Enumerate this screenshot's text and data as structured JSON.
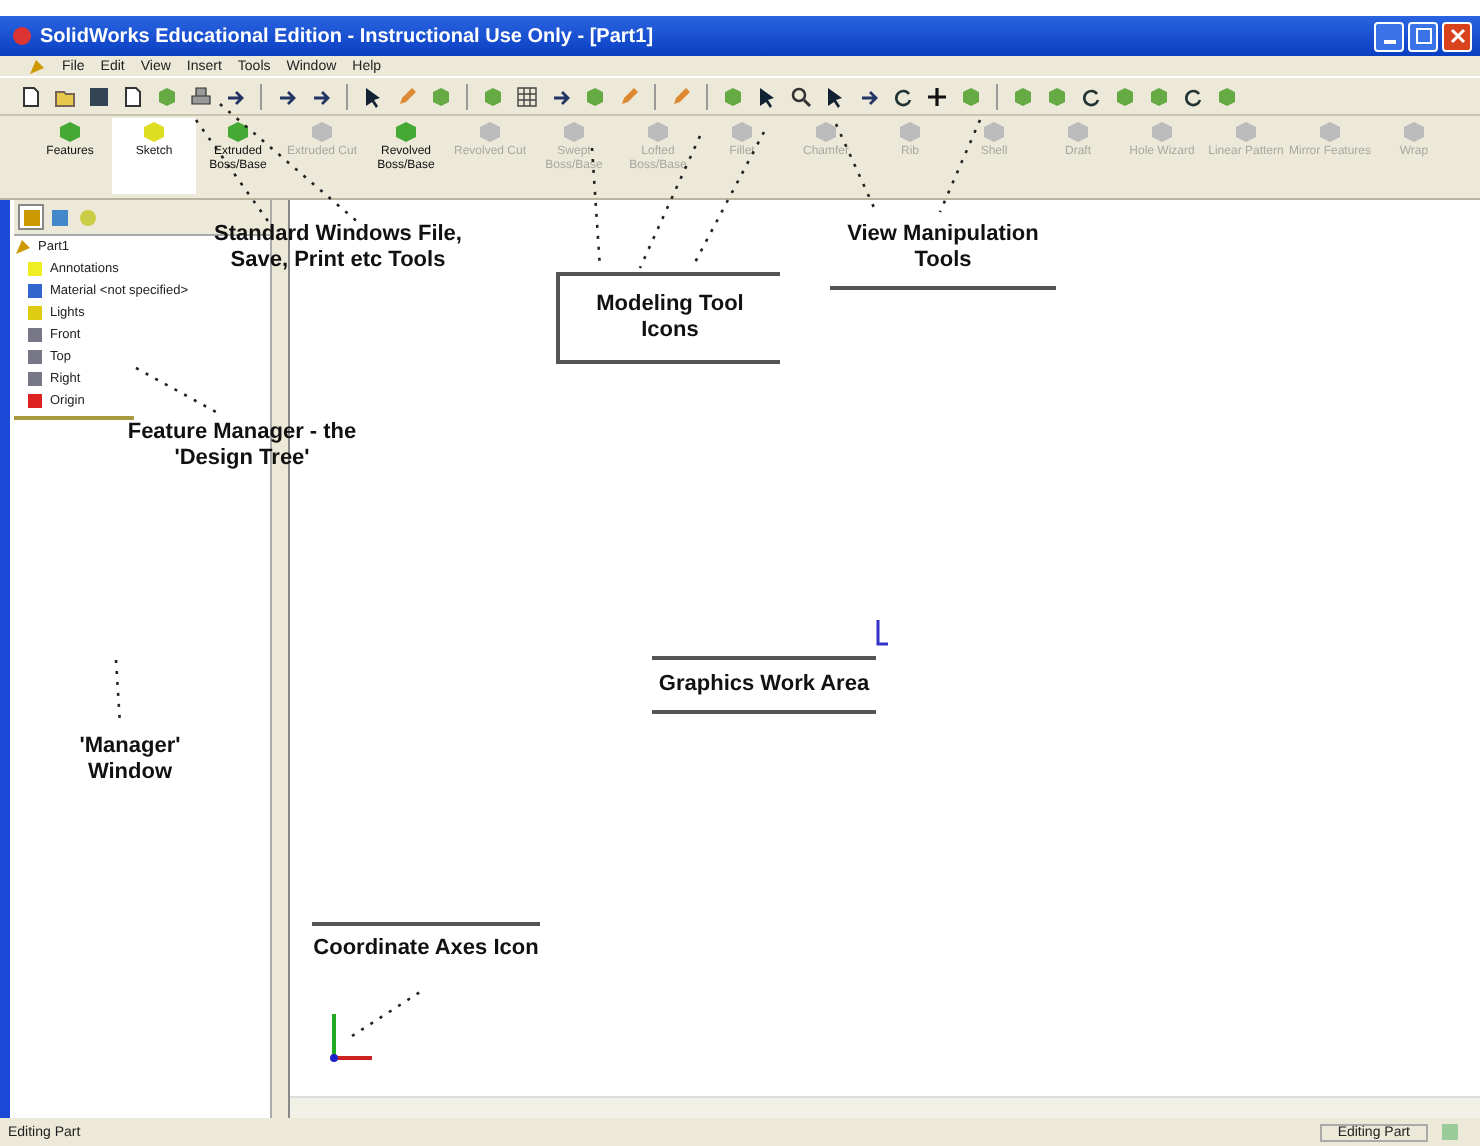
{
  "window": {
    "title": "SolidWorks Educational Edition - Instructional Use Only - [Part1]"
  },
  "menu": [
    "File",
    "Edit",
    "View",
    "Insert",
    "Tools",
    "Window",
    "Help"
  ],
  "command_manager": [
    {
      "label": "Features",
      "selected": false,
      "disabled": false
    },
    {
      "label": "Sketch",
      "selected": true,
      "disabled": false
    },
    {
      "label": "Extruded Boss/Base",
      "selected": false,
      "disabled": false
    },
    {
      "label": "Extruded Cut",
      "selected": false,
      "disabled": true
    },
    {
      "label": "Revolved Boss/Base",
      "selected": false,
      "disabled": false
    },
    {
      "label": "Revolved Cut",
      "selected": false,
      "disabled": true
    },
    {
      "label": "Swept Boss/Base",
      "selected": false,
      "disabled": true
    },
    {
      "label": "Lofted Boss/Base",
      "selected": false,
      "disabled": true
    },
    {
      "label": "Fillet",
      "selected": false,
      "disabled": true
    },
    {
      "label": "Chamfer",
      "selected": false,
      "disabled": true
    },
    {
      "label": "Rib",
      "selected": false,
      "disabled": true
    },
    {
      "label": "Shell",
      "selected": false,
      "disabled": true
    },
    {
      "label": "Draft",
      "selected": false,
      "disabled": true
    },
    {
      "label": "Hole Wizard",
      "selected": false,
      "disabled": true
    },
    {
      "label": "Linear Pattern",
      "selected": false,
      "disabled": true
    },
    {
      "label": "Mirror Features",
      "selected": false,
      "disabled": true
    },
    {
      "label": "Wrap",
      "selected": false,
      "disabled": true
    }
  ],
  "manager_tabs": [
    {
      "selected": true
    },
    {
      "selected": false
    },
    {
      "selected": false
    }
  ],
  "tree": [
    {
      "label": "Part1",
      "children": [
        {
          "label": "Annotations"
        },
        {
          "label": "Material <not specified>"
        },
        {
          "label": "Lights"
        },
        {
          "label": "Front"
        },
        {
          "label": "Top"
        },
        {
          "label": "Right"
        },
        {
          "label": "Origin"
        }
      ]
    }
  ],
  "callouts": [
    {
      "kind": "plain",
      "text": "Standard Windows File, Save, Print etc Tools"
    },
    {
      "kind": "boxed",
      "text": "Modeling Tool Icons"
    },
    {
      "kind": "underlined",
      "text": "View Manipulation Tools"
    },
    {
      "kind": "plain",
      "text": "Feature Manager - the 'Design Tree'"
    },
    {
      "kind": "plain",
      "text": "'Manager' Window"
    },
    {
      "kind": "ruled",
      "text": "Graphics Work Area"
    },
    {
      "kind": "overlined",
      "text": "Coordinate Axes Icon"
    }
  ],
  "status_bar": {
    "left": "Editing Part",
    "right": "Editing Part"
  }
}
